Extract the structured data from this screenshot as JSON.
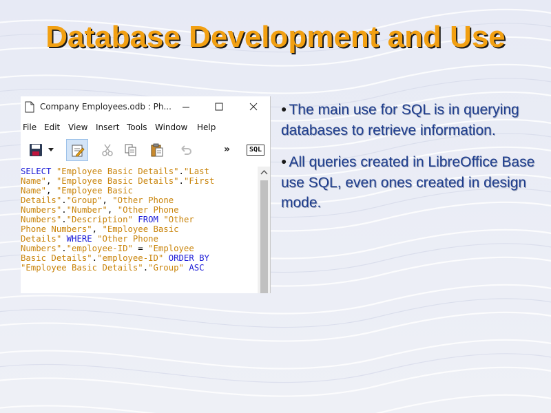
{
  "slide": {
    "title": "Database Development  and Use"
  },
  "window": {
    "title": "Company Employees.odb : Ph...",
    "menu": [
      "File",
      "Edit",
      "View",
      "Insert",
      "Tools",
      "Window",
      "Help"
    ],
    "toolbar": {
      "sql_label": "SQL",
      "more_label": "»"
    },
    "sql": {
      "select_kw": "SELECT",
      "from_kw": "FROM",
      "where_kw": "WHERE",
      "orderby_kw": "ORDER BY",
      "asc_kw": "ASC"
    }
  },
  "bullets": [
    "The main use for SQL is in querying databases to retrieve information.",
    "All queries created in LibreOffice Base use SQL, even ones created in design mode."
  ],
  "colors": {
    "title": "#f2a012",
    "bullet_text": "#1f3e8e",
    "sql_keyword": "#1b1bd6",
    "sql_string": "#c9840b"
  }
}
